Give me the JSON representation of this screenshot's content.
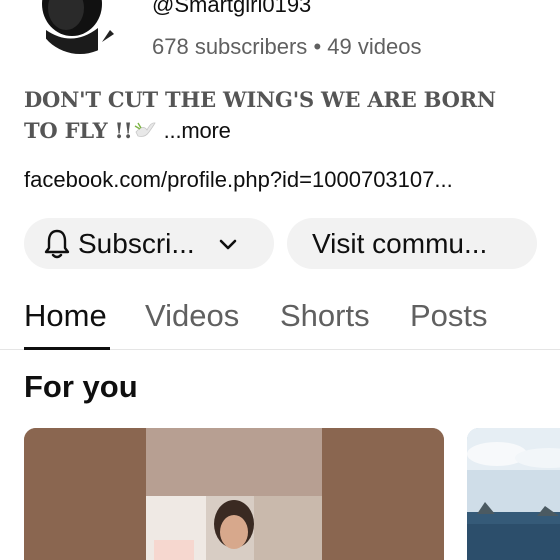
{
  "channel": {
    "handle": "@Smartgirl0193",
    "subscribers": "678 subscribers",
    "separator": "•",
    "videos": "49 videos",
    "avatar_icon": "profile-photo"
  },
  "bio": {
    "text": "DON'T CUT THE WING'S WE ARE BORN TO FLY !!",
    "emoji_icon": "dove-icon",
    "more_label": "...more"
  },
  "link": {
    "text": "facebook.com/profile.php?id=1000703107..."
  },
  "actions": {
    "subscribe_label": "Subscri...",
    "subscribe_icon": "bell-icon",
    "subscribe_dropdown_icon": "chevron-down-icon",
    "visit_label": "Visit commu..."
  },
  "tabs": [
    {
      "label": "Home",
      "active": true
    },
    {
      "label": "Videos",
      "active": false
    },
    {
      "label": "Shorts",
      "active": false
    },
    {
      "label": "Posts",
      "active": false
    }
  ],
  "section": {
    "title": "For you"
  },
  "colors": {
    "text_primary": "#0f0f0f",
    "text_secondary": "#606060",
    "pill_bg": "#f2f2f2"
  }
}
